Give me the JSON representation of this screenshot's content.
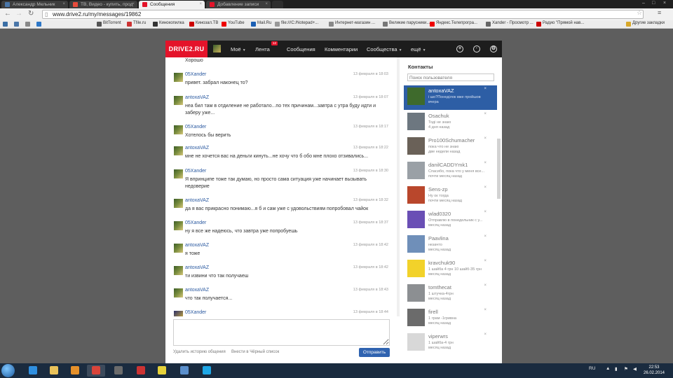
{
  "browser": {
    "tabs": [
      {
        "label": "Александр Мельник",
        "active": false,
        "color": "#4a76a8"
      },
      {
        "label": "ТВ, Видео - купить, прод",
        "active": false,
        "color": "#e74c3c"
      },
      {
        "label": "Сообщения",
        "active": true,
        "color": "#e4132a"
      },
      {
        "label": "Добавление записи",
        "active": false,
        "color": "#e4132a"
      }
    ],
    "url": "www.drive2.ru/my/messages/19862",
    "bookmarks": [
      {
        "label": "",
        "color": "#3a6ea5"
      },
      {
        "label": "",
        "color": "#4a76a8"
      },
      {
        "label": "",
        "color": "#888"
      },
      {
        "label": "",
        "color": "#2d77c7"
      },
      {
        "label": "BitTorrent",
        "color": "#555"
      },
      {
        "label": "Tfile.ru",
        "color": "#c33"
      },
      {
        "label": "Кинокопилка",
        "color": "#333"
      },
      {
        "label": "Кинозал.ТВ",
        "color": "#c00"
      },
      {
        "label": "YouTube",
        "color": "#e00"
      },
      {
        "label": "Mail.Ru",
        "color": "#1a5fb4"
      },
      {
        "label": "file:///C:/Notepad+...",
        "color": "#999"
      },
      {
        "label": "Интернет-магазин ...",
        "color": "#888"
      },
      {
        "label": "Великие парусники...",
        "color": "#777"
      },
      {
        "label": "Яндекс.Телепрогра...",
        "color": "#e00"
      },
      {
        "label": "Xander - Просмотр ...",
        "color": "#666"
      },
      {
        "label": "Радио \"Прямой нав...",
        "color": "#c00"
      },
      {
        "label": "Другие закладки",
        "color": "#d8a82a"
      }
    ]
  },
  "site": {
    "logo": "DRIVE2.RU",
    "nav": [
      {
        "label": "Моё",
        "caret": "▼"
      },
      {
        "label": "Лента",
        "caret": ""
      },
      {
        "label": "Сообщения",
        "caret": ""
      },
      {
        "label": "Комментарии",
        "caret": ""
      },
      {
        "label": "Сообщества",
        "caret": "▼"
      },
      {
        "label": "ещё",
        "caret": "▼"
      }
    ],
    "feed_badge": "12",
    "icons": [
      "add-icon",
      "search-icon",
      "settings-icon"
    ]
  },
  "messages": [
    {
      "author": "",
      "time": "",
      "text": "Хорошо",
      "avatar": "a"
    },
    {
      "author": "05Xander",
      "time": "13 февраля в 18:03",
      "text": "привет. забрал наконец то?",
      "avatar": "a"
    },
    {
      "author": "antoxaVAZ",
      "time": "13 февраля в 18:07",
      "text": "неа бил там в отдиление не работало...по тех причинам...завтра с утра буду идти и заберу уже...",
      "avatar": "a"
    },
    {
      "author": "05Xander",
      "time": "13 февраля в 18:17",
      "text": "Хотелось бы верить",
      "avatar": "a"
    },
    {
      "author": "antoxaVAZ",
      "time": "13 февраля в 18:22",
      "text": "мне не хочется вас на деньги кинуть...не хочу что б обо мне плохо отзивались...",
      "avatar": "a"
    },
    {
      "author": "05Xander",
      "time": "13 февраля в 18:30",
      "text": "Я впринципе тоже так думаю, но просто сама ситуация уже начинает вызывать недоверие",
      "avatar": "a"
    },
    {
      "author": "antoxaVAZ",
      "time": "13 февраля в 18:32",
      "text": "да я вас прикрасно понимаю...я б и сам уже с удовольствиям попробовал чайок",
      "avatar": "a"
    },
    {
      "author": "05Xander",
      "time": "13 февраля в 18:37",
      "text": "ну я все же надеюсь, что завтра уже попробуешь",
      "avatar": "a"
    },
    {
      "author": "antoxaVAZ",
      "time": "13 февраля в 18:42",
      "text": "я тоже",
      "avatar": "a"
    },
    {
      "author": "antoxaVAZ",
      "time": "13 февраля в 18:42",
      "text": "ти извини что так получаеш",
      "avatar": "a"
    },
    {
      "author": "antoxaVAZ",
      "time": "13 февраля в 18:43",
      "text": "что так получается...",
      "avatar": "a"
    },
    {
      "author": "05Xander",
      "time": "13 февраля в 18:44",
      "text": "",
      "avatar": "b"
    }
  ],
  "compose": {
    "clear_history": "Удалить историю общения",
    "blacklist": "Внести в Чёрный список",
    "send": "Отправить"
  },
  "contacts": {
    "title": "Контакты",
    "search_placeholder": "Поиск пользователя",
    "items": [
      {
        "name": "antoxaVAZ",
        "message": "i шо?Понеділок вже пройшов",
        "date": "вчера",
        "active": true,
        "color": "#3e6a2c"
      },
      {
        "name": "Osachuk",
        "message": "Тоді не знаю",
        "date": "4 дня назад",
        "active": false,
        "color": "#6d7780"
      },
      {
        "name": "Pro100Schumacher",
        "message": "пока что не знаю",
        "date": "две недели назад",
        "active": false,
        "color": "#6a6158"
      },
      {
        "name": "danilCADDYmk1",
        "message": "Спасибо, пока что у меня все...",
        "date": "почти месяц назад",
        "active": false,
        "color": "#9aa0a6"
      },
      {
        "name": "Sens-zp",
        "message": "Ну ок тогда",
        "date": "почти месяц назад",
        "active": false,
        "color": "#b9472c"
      },
      {
        "name": "wlad0320",
        "message": "Отправлю в понедельник с у...",
        "date": "месяц назад",
        "active": false,
        "color": "#6a4fb5"
      },
      {
        "name": "Paavlina",
        "message": "незачто",
        "date": "месяц назад",
        "active": false,
        "color": "#6f8fb9"
      },
      {
        "name": "kravchuk90",
        "message": "1 шайба 4 грн 10 шайб-35 грн",
        "date": "месяц назад",
        "active": false,
        "color": "#f2d22a"
      },
      {
        "name": "tomthecat",
        "message": "1 штучка-4грн",
        "date": "месяц назад",
        "active": false,
        "color": "#8c8f92"
      },
      {
        "name": "firell",
        "message": "1 грам -1гривна",
        "date": "месяц назад",
        "active": false,
        "color": "#6b6b6b"
      },
      {
        "name": "viperwrs",
        "message": "1 шайба-4 грн",
        "date": "месяц назад",
        "active": false,
        "color": "#d8d8d8"
      }
    ]
  },
  "taskbar": {
    "apps": [
      {
        "name": "ie-icon",
        "color": "#2f8fe0",
        "active": false
      },
      {
        "name": "explorer-icon",
        "color": "#e9c25a",
        "active": false
      },
      {
        "name": "media-player-icon",
        "color": "#e5902a",
        "active": false
      },
      {
        "name": "chrome-icon",
        "color": "#d9443a",
        "active": true
      },
      {
        "name": "world-of-tanks-icon",
        "color": "#6b6b6b",
        "active": false
      },
      {
        "name": "apps-grid-icon",
        "color": "#c33",
        "active": false
      },
      {
        "name": "warning-app-icon",
        "color": "#e6d23a",
        "active": false
      },
      {
        "name": "plane-game-icon",
        "color": "#5a8fcc",
        "active": false
      },
      {
        "name": "skype-icon",
        "color": "#1ea7e6",
        "active": false
      }
    ],
    "lang": "RU",
    "time": "22:53",
    "date": "26.02.2014"
  }
}
